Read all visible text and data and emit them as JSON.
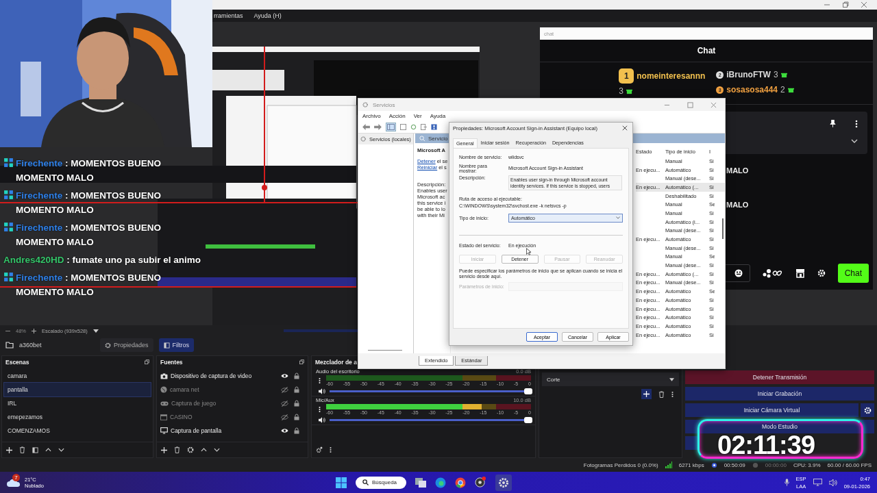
{
  "window": {
    "menu": [
      "rramientas",
      "Ayuda (H)"
    ]
  },
  "preview": {
    "chat_overlay": [
      {
        "user": "Firechente",
        "color": "#2f80e8",
        "badge": true,
        "text": ": MOMENTOS BUENO MOMENTO MALO"
      },
      {
        "user": "Firechente",
        "color": "#2f80e8",
        "badge": true,
        "text": ": MOMENTOS BUENO MOMENTO MALO"
      },
      {
        "user": "Firechente",
        "color": "#2f80e8",
        "badge": true,
        "text": ": MOMENTOS BUENO MOMENTO MALO"
      },
      {
        "user": "Andres420HD",
        "color": "#35c56a",
        "badge": false,
        "text": ": fumate uno pa subir el animo"
      },
      {
        "user": "Firechente",
        "color": "#2f80e8",
        "badge": true,
        "text": ": MOMENTOS BUENO MOMENTO MALO"
      }
    ]
  },
  "chat_dock": {
    "title": "chat",
    "header": "Chat",
    "leaders": [
      {
        "rank": "1",
        "name": "nomeinteresannn",
        "count": "3",
        "color": "#f2c04e"
      },
      {
        "rank": "2",
        "name": "iBrunoFTW",
        "count": "3",
        "color": "#dddddd"
      },
      {
        "rank": "3",
        "name": "sosasosa444",
        "count": "2",
        "color": "#f0a040"
      }
    ],
    "messages": [
      "MALO",
      "MALO"
    ],
    "send_button": "Chat"
  },
  "services": {
    "title": "Servicios",
    "menu": [
      "Archivo",
      "Acción",
      "Ver",
      "Ayuda"
    ],
    "tree": "Servicios (locales)",
    "header": "Servicio",
    "detail": {
      "name": "Microsoft A",
      "links": [
        {
          "text": "Detener",
          "rest": "el se"
        },
        {
          "text": "Reiniciar",
          "rest": "el s"
        }
      ],
      "description_label": "Descripción:",
      "description_lines": [
        "Enables user",
        "Microsoft ac",
        "this service i",
        "be able to lo",
        "with their Mi"
      ]
    },
    "columns": [
      "Estado",
      "Tipo de inicio",
      "I"
    ],
    "rows": [
      {
        "status": "",
        "startup": "Manual",
        "column_3": "Si"
      },
      {
        "status": "En ejecu...",
        "startup": "Automático",
        "column_3": "Si"
      },
      {
        "status": "",
        "startup": "Manual (dese...",
        "column_3": "Si"
      },
      {
        "status": "En ejecu...",
        "startup": "Automático (...",
        "column_3": "Si"
      },
      {
        "status": "",
        "startup": "Deshabilitado",
        "column_3": "Si"
      },
      {
        "status": "",
        "startup": "Manual",
        "column_3": "Se"
      },
      {
        "status": "",
        "startup": "Manual",
        "column_3": "Si"
      },
      {
        "status": "",
        "startup": "Automático (i...",
        "column_3": "Si"
      },
      {
        "status": "",
        "startup": "Manual (dese...",
        "column_3": "Si"
      },
      {
        "status": "En ejecu...",
        "startup": "Automático",
        "column_3": "Si"
      },
      {
        "status": "",
        "startup": "Manual (dese...",
        "column_3": "Si"
      },
      {
        "status": "",
        "startup": "Manual",
        "column_3": "Se"
      },
      {
        "status": "",
        "startup": "Manual (dese...",
        "column_3": "Si"
      },
      {
        "status": "En ejecu...",
        "startup": "Automático (...",
        "column_3": "Si"
      },
      {
        "status": "En ejecu...",
        "startup": "Manual (dese...",
        "column_3": "Si"
      },
      {
        "status": "En ejecu...",
        "startup": "Automático",
        "column_3": "Se"
      },
      {
        "status": "En ejecu...",
        "startup": "Automático",
        "column_3": "Si"
      },
      {
        "status": "En ejecu...",
        "startup": "Automático",
        "column_3": "Si"
      },
      {
        "status": "En ejecu...",
        "startup": "Automático",
        "column_3": "Si"
      },
      {
        "status": "En ejecu...",
        "startup": "Automático",
        "column_3": "Si"
      },
      {
        "status": "En ejecu...",
        "startup": "Automático",
        "column_3": "Si"
      }
    ],
    "tabs": [
      {
        "label": "Extendido",
        "selected": true
      },
      {
        "label": "Estándar",
        "selected": false
      }
    ]
  },
  "dialog": {
    "title": "Propiedades: Microsoft Account Sign-in Assistant (Equipo local)",
    "tabs": [
      {
        "label": "General",
        "selected": true
      },
      {
        "label": "Iniciar sesión",
        "selected": false
      },
      {
        "label": "Recuperación",
        "selected": false
      },
      {
        "label": "Dependencias",
        "selected": false
      }
    ],
    "fields": [
      {
        "label": "Nombre de servicio:",
        "value": "wlidsvc"
      },
      {
        "label": "Nombre para mostrar:",
        "value": "Microsoft Account Sign-in Assistant"
      }
    ],
    "description": {
      "label": "Descripción:",
      "value": "Enables user sign-in through Microsoft account identity services. If this service is stopped, users"
    },
    "path": {
      "label": "Ruta de acceso al ejecutable:",
      "value": "C:\\WINDOWS\\system32\\svchost.exe -k netsvcs -p"
    },
    "startup": {
      "label": "Tipo de inicio:",
      "value": "Automático"
    },
    "status": {
      "label": "Estado del servicio:",
      "value": "En ejecución"
    },
    "service_buttons": [
      {
        "label": "Iniciar",
        "disabled": true
      },
      {
        "label": "Detener",
        "disabled": false
      },
      {
        "label": "Pausar",
        "disabled": true
      },
      {
        "label": "Reanudar",
        "disabled": true
      }
    ],
    "hint": "Puede especificar los parámetros de inicio que se aplican cuando se inicia el servicio desde aquí.",
    "params": {
      "label": "Parámetros de inicio:",
      "disabled": true
    },
    "buttons": [
      {
        "label": "Aceptar",
        "default": true
      },
      {
        "label": "Cancelar",
        "default": false
      },
      {
        "label": "Aplicar",
        "default": false
      }
    ]
  },
  "preview_bar": {
    "zoom": "48%",
    "scale": "Escalado (939x528)"
  },
  "source_bar": {
    "source": "a360bet",
    "buttons": [
      {
        "label": "Propiedades",
        "selected": false
      },
      {
        "label": "Filtros",
        "selected": true
      }
    ]
  },
  "scenes": {
    "title": "Escenas",
    "items": [
      {
        "label": "camara",
        "selected": false
      },
      {
        "label": "pantalla",
        "selected": true
      },
      {
        "label": "IRL",
        "selected": false
      },
      {
        "label": "emepezamos",
        "selected": false
      },
      {
        "label": "COMENZAMOS",
        "selected": false
      }
    ]
  },
  "sources": {
    "title": "Fuentes",
    "items": [
      {
        "label": "Dispositivo de captura de video",
        "kind": "camera",
        "visible": true
      },
      {
        "label": "camara net",
        "kind": "browser",
        "visible": false
      },
      {
        "label": "Captura de juego",
        "kind": "game",
        "visible": false
      },
      {
        "label": "CASINO",
        "kind": "window",
        "visible": false
      },
      {
        "label": "Captura de pantalla",
        "kind": "monitor",
        "visible": true
      }
    ]
  },
  "mixer": {
    "title": "Mezclador de a",
    "channels": [
      {
        "name": "Audio del escritorio",
        "db": "0.0 dB",
        "meter": {
          "level": 0
        },
        "volume": {
          "level": 1
        },
        "scale": [
          "-60",
          "-55",
          "-50",
          "-45",
          "-40",
          "-35",
          "-30",
          "-25",
          "-20",
          "-15",
          "-10",
          "-5",
          "0"
        ]
      },
      {
        "name": "Mic/Aux",
        "db": "10.0 dB",
        "meter": {
          "level": 0.76
        },
        "volume": {
          "level": 1
        },
        "scale": [
          "-60",
          "-55",
          "-50",
          "-45",
          "-40",
          "-35",
          "-30",
          "-25",
          "-20",
          "-15",
          "-10",
          "-5",
          "0"
        ]
      }
    ]
  },
  "transitions": {
    "value": "Corte"
  },
  "controls": [
    {
      "label": "Detener Transmisión",
      "kind": "stop"
    },
    {
      "label": "Iniciar Grabación",
      "kind": "normal"
    },
    {
      "label": "Iniciar Cámara Virtual",
      "kind": "virtual"
    },
    {
      "label": "Modo Estudio",
      "kind": "normal"
    },
    {
      "kind": "covered"
    }
  ],
  "status_bar": {
    "dropped": "Fotogramas Perdidos 0 (0.0%)",
    "bitrate": "6271 kbps",
    "stream_time": "00:50:09",
    "record_time": "00:00:00",
    "cpu": "CPU: 3.9%",
    "fps": "60.00 / 60.00 FPS"
  },
  "timer": "02:11:39",
  "taskbar": {
    "weather_badge": "7",
    "temperature": "21°C",
    "condition": "Nublado",
    "search": "Búsqueda",
    "language": [
      "ESP",
      "LAA"
    ],
    "time": "0:47",
    "date": "09-01-2026"
  }
}
